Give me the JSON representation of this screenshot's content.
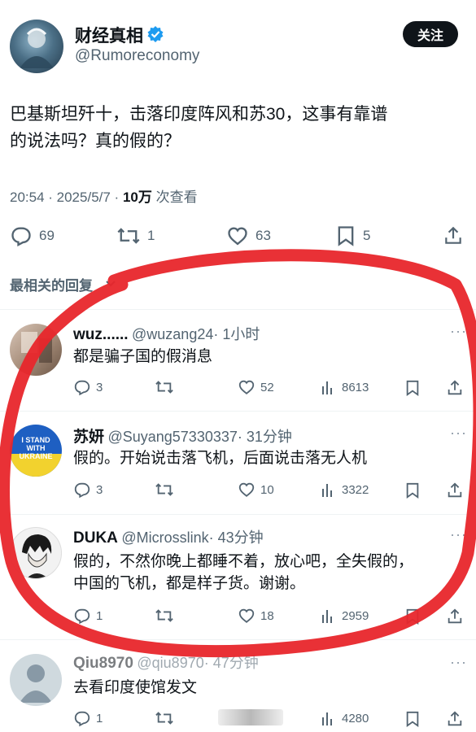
{
  "main_tweet": {
    "author_name": "财经真相",
    "author_handle": "@Rumoreconomy",
    "follow_label": "关注",
    "text_line1": "巴基斯坦歼十，击落印度阵风和苏30，这事有靠谱",
    "text_line2": "的说法吗？真的假的？",
    "time": "20:54 · 2025/5/7 · ",
    "views_count": "10万",
    "views_label": " 次查看",
    "replies": "69",
    "retweets": "1",
    "likes": "63",
    "bookmarks": "5"
  },
  "sort_label": "最相关的回复",
  "replies": [
    {
      "name": "wuz......",
      "handle": "@wuzang24",
      "time": "· 1小时",
      "text": "都是骗子国的假消息",
      "replies": "3",
      "likes": "52",
      "views": "8613"
    },
    {
      "name": "苏妍",
      "handle": "@Suyang57330337",
      "time": "· 31分钟",
      "text": "假的。开始说击落飞机，后面说击落无人机",
      "replies": "3",
      "likes": "10",
      "views": "3322"
    },
    {
      "name": "DUKA",
      "handle": "@Microsslink",
      "time": "· 43分钟",
      "text_line1": "假的，不然你晚上都睡不着，放心吧，全失假的，",
      "text_line2": "中国的飞机，都是样子货。谢谢。",
      "replies": "1",
      "likes": "18",
      "views": "2959"
    },
    {
      "name": "Qiu8970",
      "handle": "@qiu8970",
      "time": "· 47分钟",
      "text": "去看印度使馆发文",
      "replies": "1",
      "views": "4280"
    }
  ],
  "badge_text": "I STAND WITH UKRAINE",
  "colors": {
    "accent": "#1d9bf0",
    "annotation": "#e8262b",
    "text": "#0f1419",
    "muted": "#536471"
  },
  "icons": [
    "verified-badge-icon",
    "reply-icon",
    "retweet-icon",
    "like-icon",
    "bookmark-icon",
    "share-icon",
    "views-icon",
    "more-icon"
  ]
}
